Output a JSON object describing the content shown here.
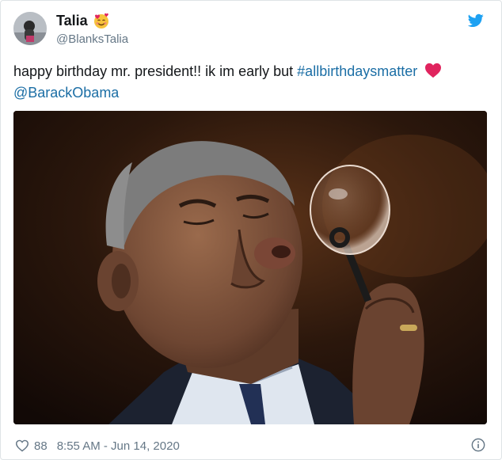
{
  "tweet": {
    "author": {
      "display_name": "Talia",
      "handle": "@BlanksTalia",
      "name_emoji_icon": "smiling-face-with-hearts-icon",
      "avatar_icon": "avatar"
    },
    "platform_icon": "twitter-bird-icon",
    "text": {
      "plain": "happy birthday mr. president!! ik im early but ",
      "hashtag": "#allbirthdaysmatter",
      "emoji_icon": "red-heart-icon",
      "mention": "@BarackObama"
    },
    "media": {
      "type": "photo"
    },
    "footer": {
      "like_icon": "heart-outline-icon",
      "like_count": "88",
      "timestamp": "8:55 AM - Jun 14, 2020",
      "info_icon": "info-icon"
    }
  },
  "colors": {
    "link": "#1b6ea5",
    "twitter_blue": "#1da1f2",
    "secondary_text": "#657786",
    "heart_red": "#e0245e"
  }
}
